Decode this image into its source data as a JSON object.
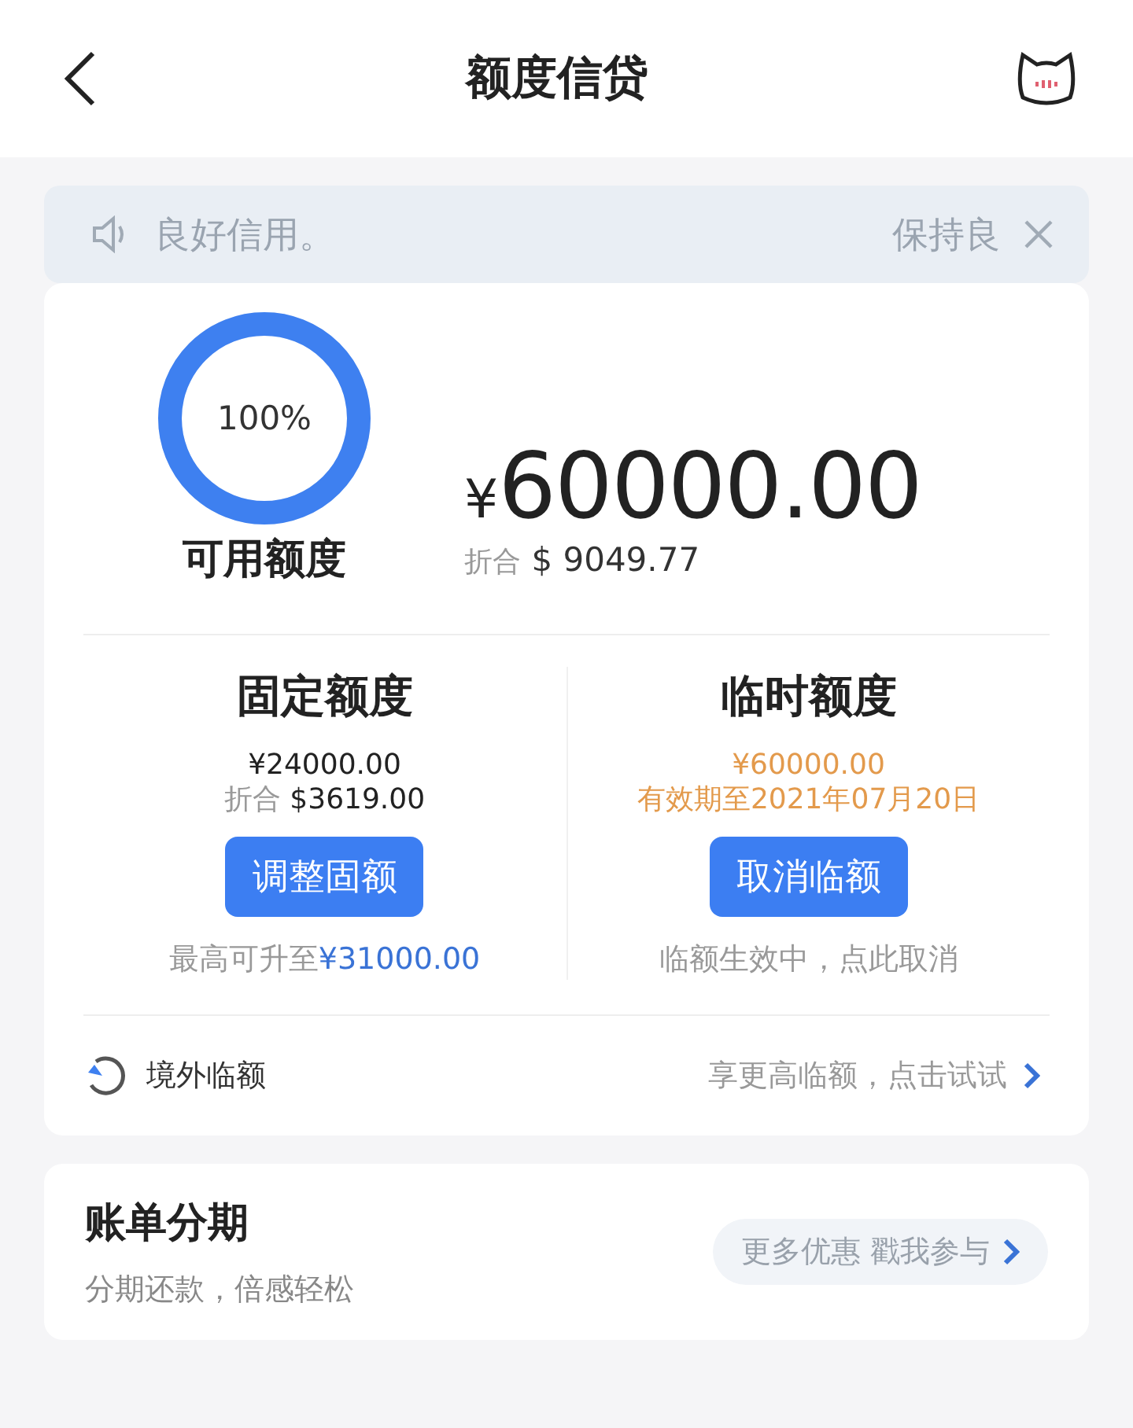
{
  "header": {
    "title": "额度信贷"
  },
  "notice": {
    "texts": [
      "良好信用。",
      "保持良"
    ]
  },
  "summary": {
    "ring_label": "100%",
    "level": 1,
    "caption": "可用额度",
    "currency": "¥",
    "amount": "60000.00",
    "converted_label": "折合",
    "converted": "$ 9049.77"
  },
  "columns": [
    {
      "title": "固定额度",
      "amount": "¥24000.00",
      "highlighted": false,
      "sub_label": "折合",
      "sub": "$3619.00",
      "button": "调整固额",
      "note": "最高可升至",
      "note_amount": "¥31000.00"
    },
    {
      "title": "临时额度",
      "amount": "¥60000.00",
      "highlighted": true,
      "sub": "有效期至2021年07月20日",
      "button": "取消临额",
      "note": "临额生效中，点此取消"
    }
  ],
  "overseas": {
    "label": "境外临额",
    "hint": "享更高临额，点击试试"
  },
  "installment": {
    "title": "账单分期",
    "subtitle": "分期还款，倍感轻松",
    "action": "更多优惠 戳我参与"
  }
}
